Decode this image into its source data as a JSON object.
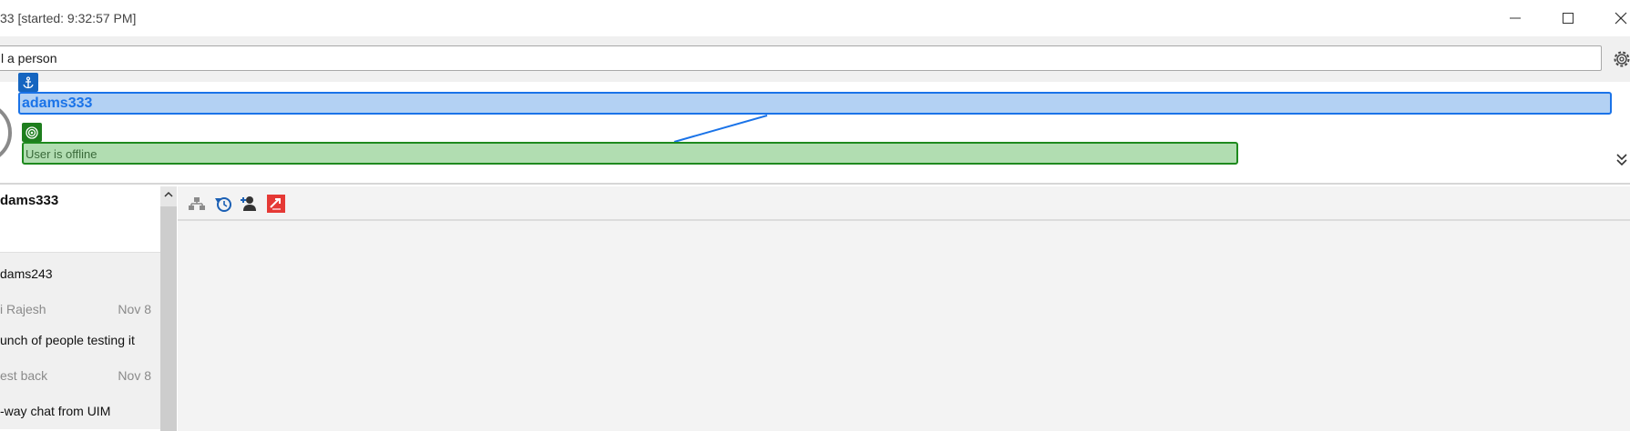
{
  "window": {
    "title": "33 [started: 9:32:57 PM]",
    "controls": {
      "minimize": "minimize",
      "maximize": "maximize",
      "close": "close"
    }
  },
  "search": {
    "value": "l a person",
    "settings_icon": "gear-icon"
  },
  "header": {
    "contact_name": "adams333",
    "status_text": "User is offline",
    "anchor_icon": "anchor-icon",
    "target_icon": "target-icon",
    "expand_icon": "double-chevron-down-icon",
    "colors": {
      "name_fill": "#b3d1f3",
      "name_border": "#1a73e8",
      "status_fill": "#b1ddb1",
      "status_border": "#1e8a1e"
    }
  },
  "conversations": {
    "header_name": "dams333",
    "items": [
      {
        "name": "dams243",
        "sender": "i Rajesh",
        "date": "Nov 8"
      }
    ],
    "messages": [
      {
        "text": "unch of people testing it",
        "sender": "est back",
        "date": "Nov 8"
      },
      {
        "text": "-way chat from UIM"
      }
    ]
  },
  "toolbar": {
    "icons": [
      "org-chart-icon",
      "history-icon",
      "add-person-icon",
      "share-icon"
    ]
  }
}
